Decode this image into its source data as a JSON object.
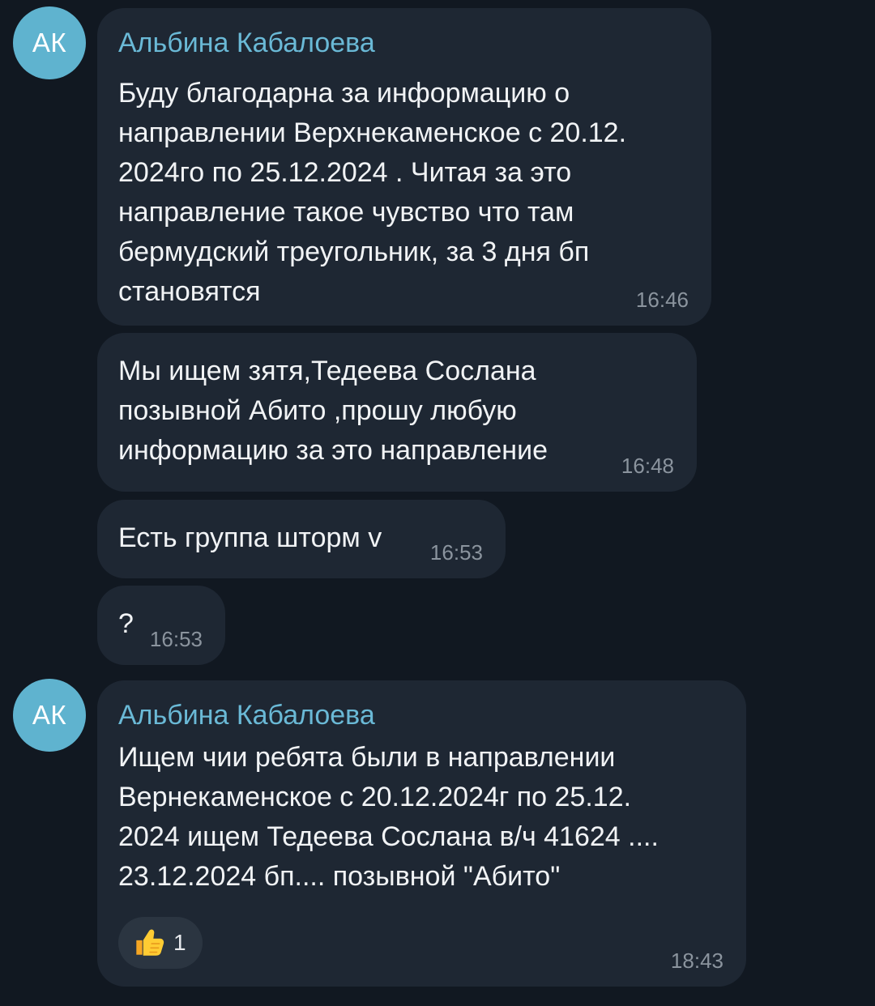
{
  "messages": [
    {
      "avatar_initials": "АК",
      "sender": "Альбина Кабалоева",
      "lines": [
        "Буду благодарна за информацию о",
        "направлении Верхнекаменское с 20.12.",
        "2024го по 25.12.2024 . Читая за это",
        "направление такое чувство что там",
        "бермудский треугольник, за 3 дня бп",
        "становятся"
      ],
      "time": "16:46"
    },
    {
      "lines": [
        "Мы ищем зятя,Тедеева Сослана",
        "позывной Абито ,прошу любую",
        "информацию за это направление"
      ],
      "time": "16:48"
    },
    {
      "lines": [
        "Есть группа шторм v"
      ],
      "time": "16:53"
    },
    {
      "lines": [
        "?"
      ],
      "time": "16:53"
    },
    {
      "avatar_initials": "АК",
      "sender": "Альбина Кабалоева",
      "lines": [
        "Ищем чии ребята были в направлении",
        "Вернекаменское с 20.12.2024г по 25.12.",
        "2024 ищем Тедеева Сослана в/ч 41624 ....",
        "23.12.2024 бп.... позывной \"Абито\""
      ],
      "reaction": {
        "icon": "thumbs-up-icon",
        "count": "1"
      },
      "time": "18:43"
    }
  ],
  "colors": {
    "background": "#111821",
    "bubble": "#1e2733",
    "sender_name": "#6ab9d6",
    "avatar": "#5fb3cf",
    "timestamp": "#8b949e"
  }
}
